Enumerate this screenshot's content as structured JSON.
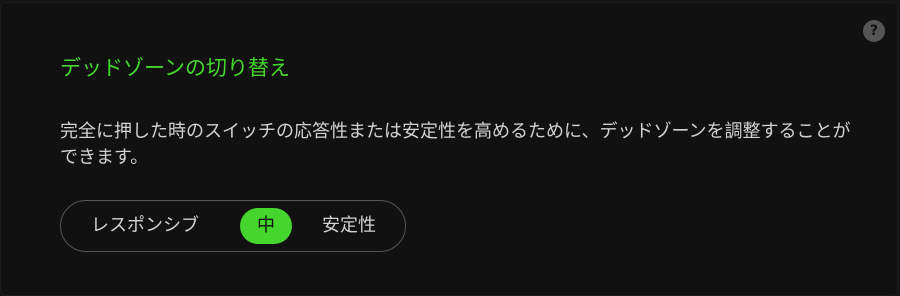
{
  "help": {
    "icon": "question-circle-icon",
    "glyph": "?"
  },
  "title": "デッドゾーンの切り替え",
  "description": "完全に押した時のスイッチの応答性または安定性を高めるために、デッドゾーンを調整することができます。",
  "deadzone": {
    "options": [
      "レスポンシブ",
      "中",
      "安定性"
    ],
    "selected": "中"
  },
  "colors": {
    "accent": "#44d62c",
    "background": "#111111",
    "text": "#d2d2d2"
  }
}
